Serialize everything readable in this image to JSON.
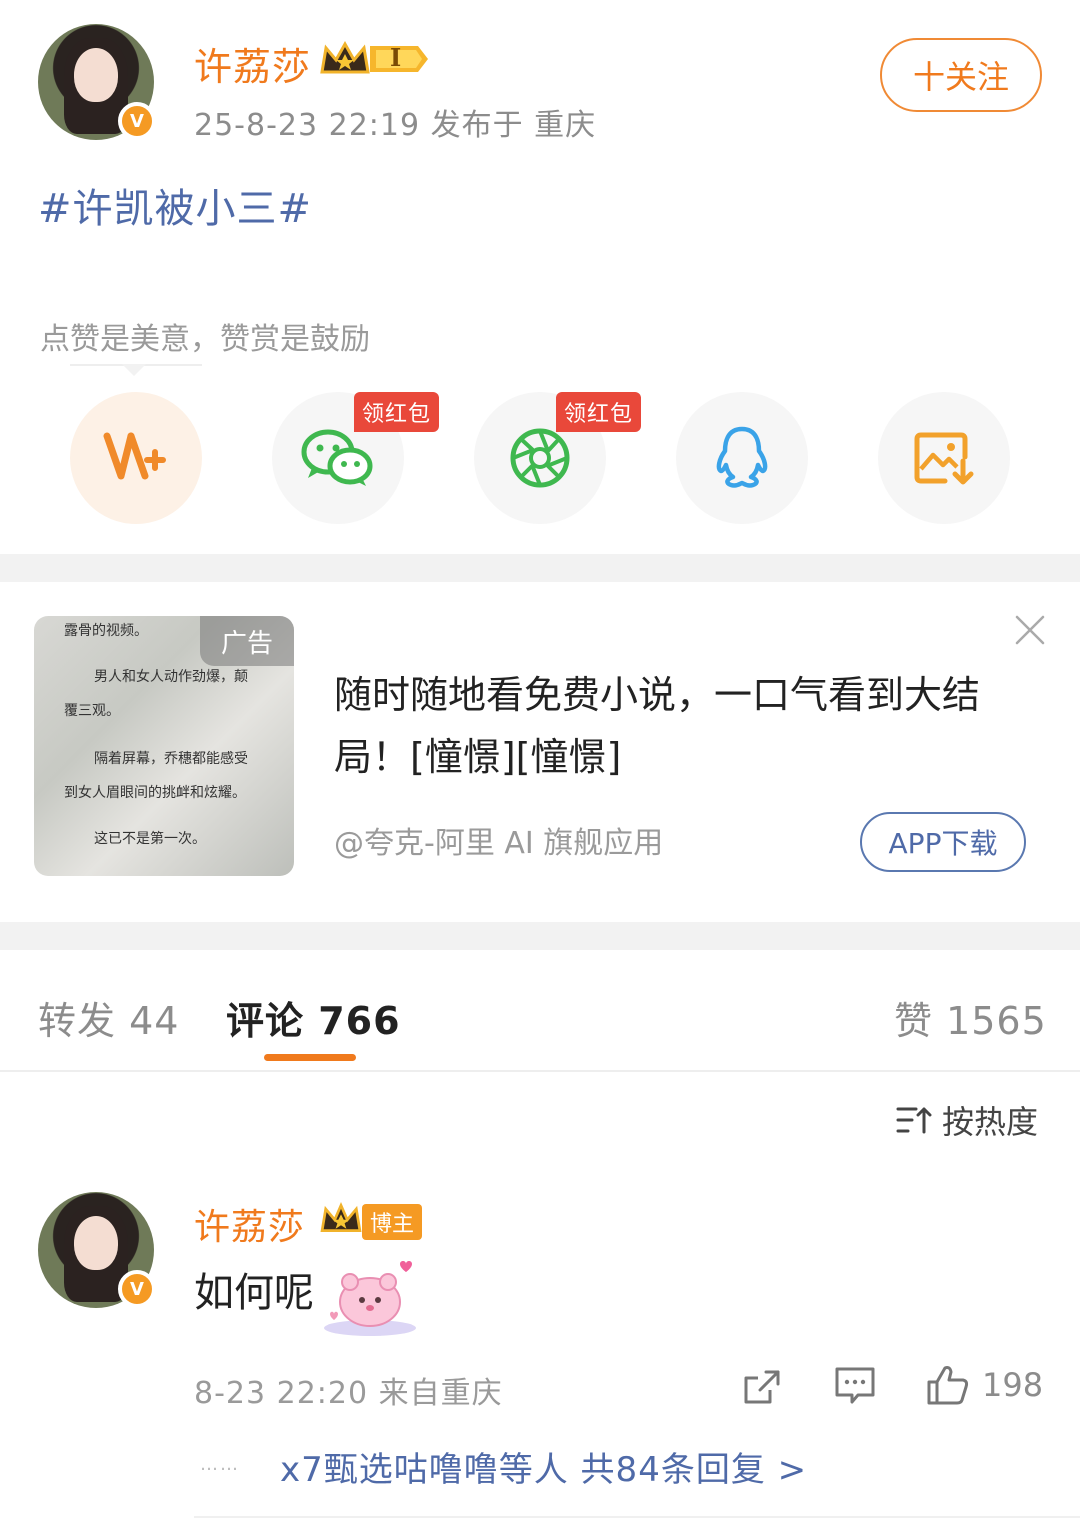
{
  "post": {
    "username": "许荔莎",
    "level_badge": "I",
    "meta": "25-8-23 22:19  发布于 重庆",
    "follow_label": "十关注",
    "topic": "#许凯被小三#",
    "reward_text": "点赞是美意，赞赏是鼓励"
  },
  "share": {
    "items": [
      {
        "icon": "weibo-reward-icon"
      },
      {
        "icon": "wechat-icon",
        "badge": "领红包"
      },
      {
        "icon": "moments-icon",
        "badge": "领红包"
      },
      {
        "icon": "qq-icon"
      },
      {
        "icon": "save-image-icon"
      }
    ]
  },
  "ad": {
    "tag": "广告",
    "thumb_lines": [
      "露骨的视频。",
      "男人和女人动作劲爆，颠",
      "覆三观。",
      "隔着屏幕，乔穗都能感受",
      "到女人眉眼间的挑衅和炫耀。",
      "这已不是第一次。"
    ],
    "title": "随时随地看免费小说，一口气看到大结局！[憧憬][憧憬]",
    "source": "@夸克-阿里 AI 旗舰应用",
    "button": "APP下载"
  },
  "tabs": {
    "repost": "转发 44",
    "comment": "评论 766",
    "like": "赞 1565"
  },
  "sort_label": "按热度",
  "comment": {
    "username": "许荔莎",
    "tag": "博主",
    "text": "如何呢",
    "meta": "8-23 22:20  来自重庆",
    "like_count": "198",
    "replies": "x7甄选咕噜噜等人  共84条回复 >",
    "dots": "……"
  },
  "colors": {
    "brand_orange": "#f07a1d",
    "link_blue": "#4f6aa8",
    "red_badge": "#e9483a"
  }
}
